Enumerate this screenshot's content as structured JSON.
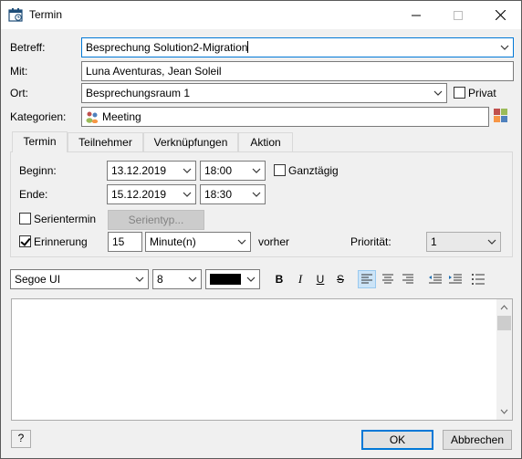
{
  "window": {
    "title": "Termin"
  },
  "form": {
    "betreff_label": "Betreff:",
    "betreff_value": "Besprechung Solution2-Migration",
    "mit_label": "Mit:",
    "mit_value": "Luna Aventuras, Jean Soleil",
    "ort_label": "Ort:",
    "ort_value": "Besprechungsraum 1",
    "privat_label": "Privat",
    "privat_checked": false,
    "kategorien_label": "Kategorien:",
    "kategorien_value": "Meeting"
  },
  "tabs": [
    {
      "label": "Termin",
      "active": true
    },
    {
      "label": "Teilnehmer",
      "active": false
    },
    {
      "label": "Verknüpfungen",
      "active": false
    },
    {
      "label": "Aktion",
      "active": false
    }
  ],
  "termin": {
    "beginn_label": "Beginn:",
    "beginn_date": "13.12.2019",
    "beginn_time": "18:00",
    "ganztaegig_label": "Ganztägig",
    "ganztaegig_checked": false,
    "ende_label": "Ende:",
    "ende_date": "15.12.2019",
    "ende_time": "18:30",
    "serientermin_label": "Serientermin",
    "serientermin_checked": false,
    "serientyp_label": "Serientyp...",
    "erinnerung_label": "Erinnerung",
    "erinnerung_checked": true,
    "erinnerung_value": "15",
    "erinnerung_unit": "Minute(n)",
    "vorher_label": "vorher",
    "prioritaet_label": "Priorität:",
    "prioritaet_value": "1"
  },
  "toolbar": {
    "font": "Segoe UI",
    "size": "8",
    "color": "#000000",
    "bold": "B",
    "italic": "I",
    "underline": "U",
    "strike": "S"
  },
  "footer": {
    "help": "?",
    "ok": "OK",
    "cancel": "Abbrechen"
  },
  "colors": {
    "accent": "#0078d7",
    "window_bg": "#f0f0f0"
  }
}
